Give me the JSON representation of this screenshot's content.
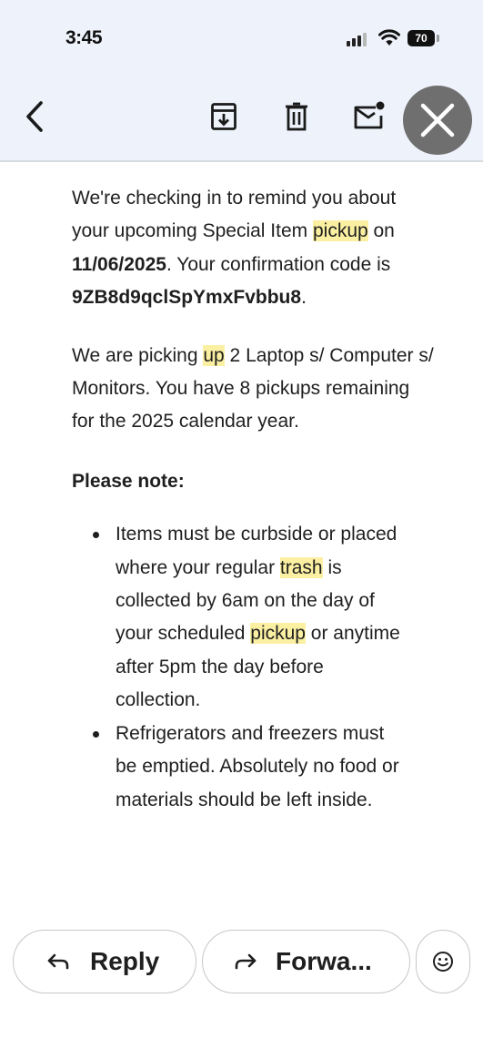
{
  "status_bar": {
    "time": "3:45",
    "battery": "70"
  },
  "toolbar": {
    "back_icon": "arrow-back-icon",
    "archive_icon": "archive-icon",
    "delete_icon": "trash-icon",
    "mark_unread_icon": "mark-unread-icon",
    "close_icon": "close-icon"
  },
  "email": {
    "p1": {
      "t1": "We're checking in to remind you about your upcoming Special Item ",
      "t2": "pickup",
      "t3": " on ",
      "date": "11/06/2025",
      "t4": ". Your confirmation code is ",
      "code": "9ZB8d9qclSpYmxFvbbu8",
      "t5": "."
    },
    "p2": {
      "t1": "We are picking ",
      "t2": "up",
      "t3": " 2 Laptop s/ Computer s/ Monitors. You have 8 pickups remaining for the 2025 calendar year."
    },
    "note_heading": "Please note:",
    "bullet1": {
      "t1": "Items must be curbside or placed where your regular ",
      "t2": "trash",
      "t3": " is collected by 6am on the day of your scheduled ",
      "t4": "pickup",
      "t5": " or anytime after 5pm the day before collection."
    },
    "bullet2": "Refrigerators and freezers must be emptied. Absolutely no food or materials should be left inside."
  },
  "actions": {
    "reply_label": "Reply",
    "forward_label": "Forwa...",
    "reply_icon": "reply-arrow-icon",
    "forward_icon": "forward-arrow-icon",
    "emoji_icon": "emoji-icon"
  },
  "colors": {
    "highlight": "#fbf0a2",
    "toolbar_bg": "#eef2fb",
    "close_fab_bg": "#6f6f6f"
  }
}
